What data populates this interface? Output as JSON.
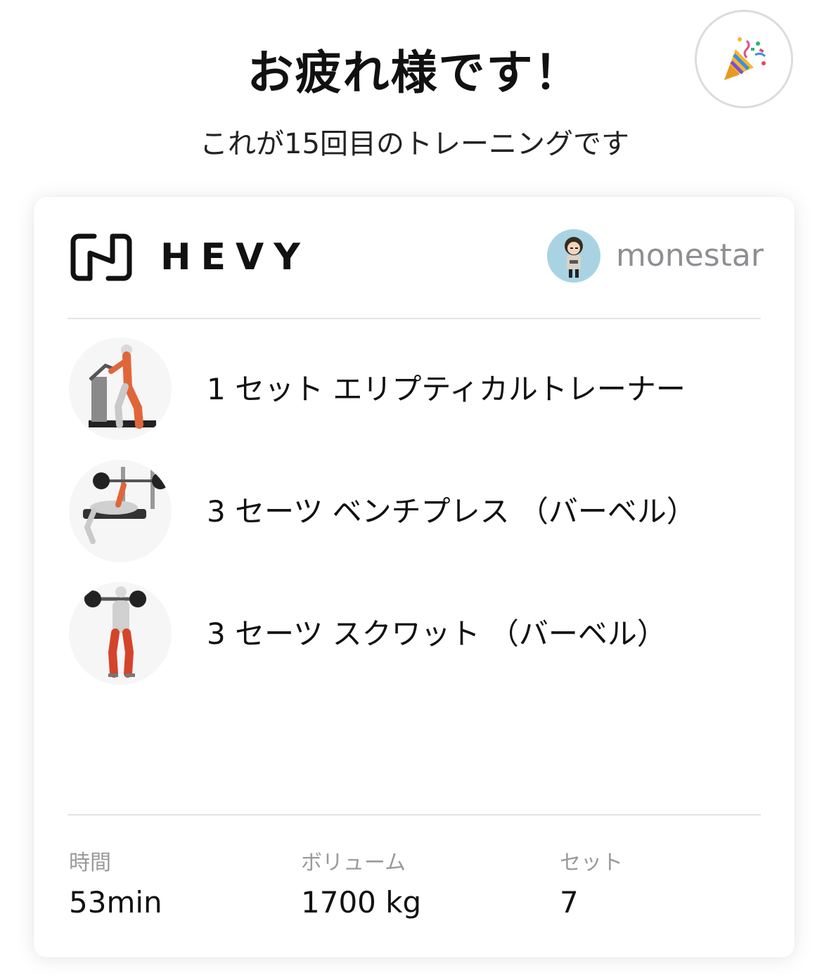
{
  "header": {
    "title": "お疲れ様です！",
    "subtitle": "これが15回目のトレーニングです",
    "party_icon": "party-popper-icon"
  },
  "card": {
    "brand": "HEVY",
    "username": "monestar",
    "exercises": [
      {
        "text": "1 セット エリプティカルトレーナー",
        "icon": "elliptical-trainer-icon"
      },
      {
        "text": "3 セーツ ベンチプレス （バーベル）",
        "icon": "bench-press-icon"
      },
      {
        "text": "3 セーツ スクワット （バーベル）",
        "icon": "squat-icon"
      }
    ],
    "stats": [
      {
        "label": "時間",
        "value": "53min"
      },
      {
        "label": "ボリューム",
        "value": "1700 kg"
      },
      {
        "label": "セット",
        "value": "7"
      }
    ]
  },
  "colors": {
    "text": "#111111",
    "muted": "#8e8e93",
    "divider": "#e3e3e3",
    "muscle_highlight": "#e0663a"
  }
}
